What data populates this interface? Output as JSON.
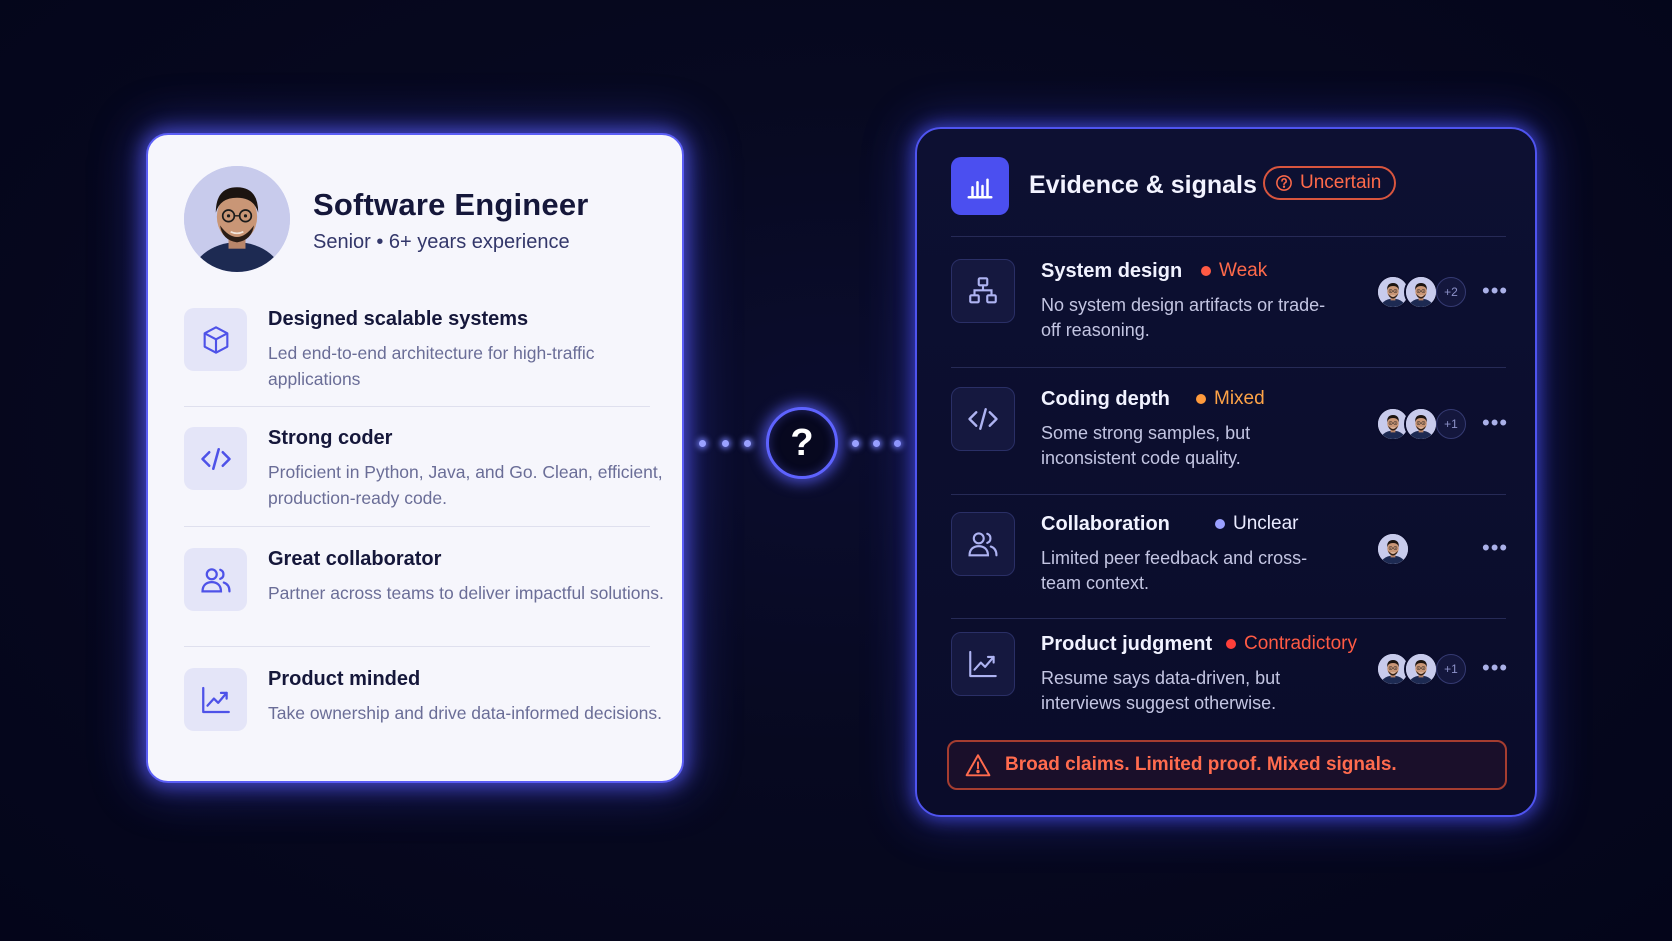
{
  "profile": {
    "title": "Software Engineer",
    "subtitle": "Senior • 6+ years experience",
    "avatar_icon": "person-portrait",
    "claims": [
      {
        "icon": "cube-icon",
        "title": "Designed scalable systems",
        "desc": "Led end-to-end architecture for high-traffic applications"
      },
      {
        "icon": "code-icon",
        "title": "Strong coder",
        "desc": "Proficient in Python, Java, and Go. Clean, efficient, production-ready code."
      },
      {
        "icon": "people-icon",
        "title": "Great collaborator",
        "desc": "Partner across teams to deliver impactful solutions."
      },
      {
        "icon": "trend-chart-icon",
        "title": "Product minded",
        "desc": "Take ownership and drive data-informed decisions."
      }
    ]
  },
  "connector": {
    "symbol": "?"
  },
  "evidence": {
    "title": "Evidence & signals",
    "badge": "Uncertain",
    "signals": [
      {
        "icon": "system-diagram-icon",
        "title": "System design",
        "status": "Weak",
        "status_color": "#ff6a4a",
        "dot_color": "#ff5a44",
        "desc": "No system design artifacts or trade-off reasoning.",
        "avatars": 2,
        "more": "+2"
      },
      {
        "icon": "code-icon",
        "title": "Coding depth",
        "status": "Mixed",
        "status_color": "#ffa347",
        "dot_color": "#ff9a3c",
        "desc": "Some strong samples, but inconsistent code quality.",
        "avatars": 2,
        "more": "+1"
      },
      {
        "icon": "people-icon",
        "title": "Collaboration",
        "status": "Unclear",
        "status_color": "#e9eaff",
        "dot_color": "#9aa0ff",
        "desc": "Limited peer feedback and cross-team context.",
        "avatars": 1,
        "more": ""
      },
      {
        "icon": "trend-chart-icon",
        "title": "Product judgment",
        "status": "Contradictory",
        "status_color": "#ff5a44",
        "dot_color": "#ff3f3a",
        "desc": "Resume says data-driven, but interviews suggest otherwise.",
        "avatars": 2,
        "more": "+1"
      }
    ],
    "more_menu": "•••",
    "warning": "Broad claims. Limited proof. Mixed signals."
  },
  "colors": {
    "accent": "#5b5ef5",
    "warning": "#ff6b4e"
  }
}
